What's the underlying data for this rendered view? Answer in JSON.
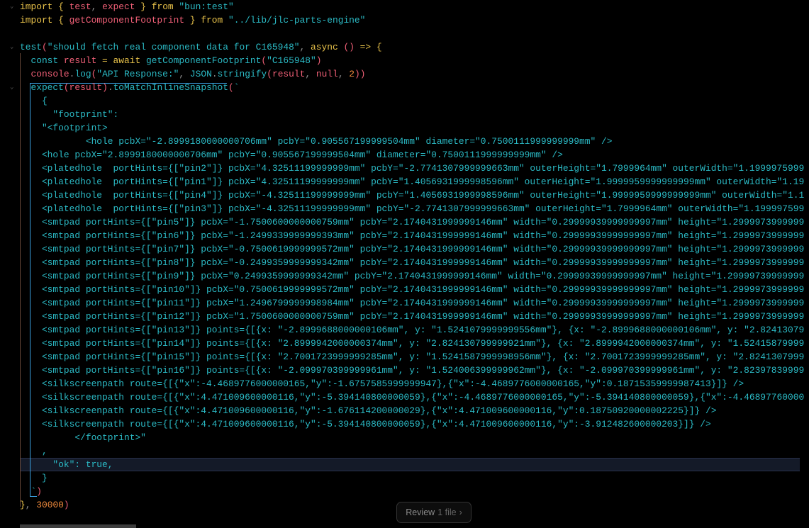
{
  "editor": {
    "lines": [
      [
        [
          "k",
          "import"
        ],
        [
          "o",
          " { "
        ],
        [
          "p",
          "test"
        ],
        [
          "g",
          ", "
        ],
        [
          "p",
          "expect"
        ],
        [
          "o",
          " } "
        ],
        [
          "k",
          "from"
        ],
        [
          "s",
          " \"bun:test\""
        ]
      ],
      [
        [
          "k",
          "import"
        ],
        [
          "o",
          " { "
        ],
        [
          "p",
          "getComponentFootprint"
        ],
        [
          "o",
          " } "
        ],
        [
          "k",
          "from"
        ],
        [
          "s",
          " \"../lib/jlc-parts-engine\""
        ]
      ],
      [],
      [
        [
          "c",
          "test"
        ],
        [
          "p",
          "("
        ],
        [
          "s",
          "\"should fetch real component data for C165948\""
        ],
        [
          "g",
          ", "
        ],
        [
          "k",
          "async"
        ],
        [
          "p",
          " () "
        ],
        [
          "o",
          "=>"
        ],
        [
          "o",
          " {"
        ]
      ],
      [
        [
          "c",
          "  const "
        ],
        [
          "p",
          "result"
        ],
        [
          "o",
          " = "
        ],
        [
          "k",
          "await "
        ],
        [
          "c",
          "getComponentFootprint"
        ],
        [
          "p",
          "("
        ],
        [
          "s",
          "\"C165948\""
        ],
        [
          "p",
          ")"
        ]
      ],
      [
        [
          "p",
          "  console"
        ],
        [
          "g",
          "."
        ],
        [
          "c",
          "log"
        ],
        [
          "p",
          "("
        ],
        [
          "s",
          "\"API Response:\""
        ],
        [
          "g",
          ", "
        ],
        [
          "c",
          "JSON"
        ],
        [
          "g",
          "."
        ],
        [
          "c",
          "stringify"
        ],
        [
          "p",
          "("
        ],
        [
          "p",
          "result"
        ],
        [
          "g",
          ", "
        ],
        [
          "p",
          "null"
        ],
        [
          "g",
          ", "
        ],
        [
          "n",
          "2"
        ],
        [
          "p",
          "))"
        ]
      ],
      [
        [
          "c",
          "  expect"
        ],
        [
          "p",
          "("
        ],
        [
          "p",
          "result"
        ],
        [
          "p",
          ")"
        ],
        [
          "g",
          "."
        ],
        [
          "c",
          "toMatchInlineSnapshot"
        ],
        [
          "p",
          "("
        ],
        [
          "s",
          "`"
        ]
      ],
      [
        [
          "s",
          "    {"
        ]
      ],
      [
        [
          "s",
          "      \"footprint\":"
        ]
      ],
      [
        [
          "s",
          "    \"<footprint>"
        ]
      ],
      [
        [
          "s",
          "            <hole pcbX=\"-2.8999180000000706mm\" pcbY=\"0.905567199999504mm\" diameter=\"0.7500111999999999mm\" />"
        ]
      ],
      [
        [
          "s",
          "    <hole pcbX=\"2.8999180000000706mm\" pcbY=\"0.905567199999504mm\" diameter=\"0.7500111999999999mm\" />"
        ]
      ],
      [
        [
          "s",
          "    <platedhole  portHints={[\"pin2\"]} pcbX=\"4.32511199999999mm\" pcbY=\"-2.7741307999999663mm\" outerHeight=\"1.7999964mm\" outerWidth=\"1.1999975999"
        ]
      ],
      [
        [
          "s",
          "    <platedhole  portHints={[\"pin1\"]} pcbX=\"4.32511199999999mm\" pcbY=\"1.4056931999998596mm\" outerHeight=\"1.9999959999999999mm\" outerWidth=\"1.19"
        ]
      ],
      [
        [
          "s",
          "    <platedhole  portHints={[\"pin4\"]} pcbX=\"-4.32511199999999mm\" pcbY=\"1.4056931999998596mm\" outerHeight=\"1.9999959999999999mm\" outerWidth=\"1.1"
        ]
      ],
      [
        [
          "s",
          "    <platedhole  portHints={[\"pin3\"]} pcbX=\"-4.32511199999999mm\" pcbY=\"-2.7741307999999663mm\" outerHeight=\"1.7999964mm\" outerWidth=\"1.199997599"
        ]
      ],
      [
        [
          "s",
          "    <smtpad portHints={[\"pin5\"]} pcbX=\"-1.7500600000000759mm\" pcbY=\"2.1740431999999146mm\" width=\"0.29999939999999997mm\" height=\"1.2999973999999"
        ]
      ],
      [
        [
          "s",
          "    <smtpad portHints={[\"pin6\"]} pcbX=\"-1.2499339999999393mm\" pcbY=\"2.1740431999999146mm\" width=\"0.29999939999999997mm\" height=\"1.2999973999999"
        ]
      ],
      [
        [
          "s",
          "    <smtpad portHints={[\"pin7\"]} pcbX=\"-0.7500619999999572mm\" pcbY=\"2.1740431999999146mm\" width=\"0.29999939999999997mm\" height=\"1.2999973999999"
        ]
      ],
      [
        [
          "s",
          "    <smtpad portHints={[\"pin8\"]} pcbX=\"-0.2499359999999342mm\" pcbY=\"2.1740431999999146mm\" width=\"0.29999939999999997mm\" height=\"1.2999973999999"
        ]
      ],
      [
        [
          "s",
          "    <smtpad portHints={[\"pin9\"]} pcbX=\"0.2499359999999342mm\" pcbY=\"2.1740431999999146mm\" width=\"0.29999939999999997mm\" height=\"1.29999739999999"
        ]
      ],
      [
        [
          "s",
          "    <smtpad portHints={[\"pin10\"]} pcbX=\"0.7500619999999572mm\" pcbY=\"2.1740431999999146mm\" width=\"0.29999939999999997mm\" height=\"1.2999973999999"
        ]
      ],
      [
        [
          "s",
          "    <smtpad portHints={[\"pin11\"]} pcbX=\"1.2496799999998984mm\" pcbY=\"2.1740431999999146mm\" width=\"0.29999939999999997mm\" height=\"1.2999973999999"
        ]
      ],
      [
        [
          "s",
          "    <smtpad portHints={[\"pin12\"]} pcbX=\"1.7500600000000759mm\" pcbY=\"2.1740431999999146mm\" width=\"0.29999939999999997mm\" height=\"1.2999973999999"
        ]
      ],
      [
        [
          "s",
          "    <smtpad portHints={[\"pin13\"]} points={[{x: \"-2.8999688000000106mm\", y: \"1.5241079999999556mm\"}, {x: \"-2.8999688000000106mm\", y: \"2.82413079"
        ]
      ],
      [
        [
          "s",
          "    <smtpad portHints={[\"pin14\"]} points={[{x: \"2.8999942000000374mm\", y: \"2.824130799999921mm\"}, {x: \"2.8999942000000374mm\", y: \"1.52415879999"
        ]
      ],
      [
        [
          "s",
          "    <smtpad portHints={[\"pin15\"]} points={[{x: \"2.7001723999999285mm\", y: \"1.5241587999998956mm\"}, {x: \"2.7001723999999285mm\", y: \"2.8241307999"
        ]
      ],
      [
        [
          "s",
          "    <smtpad portHints={[\"pin16\"]} points={[{x: \"-2.099970399999961mm\", y: \"1.524006399999962mm\"}, {x: \"-2.099970399999961mm\", y: \"2.82397839999"
        ]
      ],
      [
        [
          "s",
          "    <silkscreenpath route={[{\"x\":-4.4689776000000165,\"y\":-1.6757585999999947},{\"x\":-4.4689776000000165,\"y\":0.18715359999987413}]} />"
        ]
      ],
      [
        [
          "s",
          "    <silkscreenpath route={[{\"x\":4.471009600000116,\"y\":-5.394140800000059},{\"x\":-4.4689776000000165,\"y\":-5.394140800000059},{\"x\":-4.46897760000"
        ]
      ],
      [
        [
          "s",
          "    <silkscreenpath route={[{\"x\":4.471009600000116,\"y\":-1.676114200000029},{\"x\":4.471009600000116,\"y\":0.18750920000002225}]} />"
        ]
      ],
      [
        [
          "s",
          "    <silkscreenpath route={[{\"x\":4.471009600000116,\"y\":-5.394140800000059},{\"x\":4.471009600000116,\"y\":-3.912482600000203}]} />"
        ]
      ],
      [
        [
          "s",
          "          </footprint>\""
        ]
      ],
      [
        [
          "s",
          "    ,"
        ]
      ],
      [
        [
          "s",
          "      \"ok\": true,"
        ]
      ],
      [
        [
          "s",
          "    }"
        ]
      ],
      [
        [
          "s",
          "  `"
        ],
        [
          "p",
          ")"
        ]
      ],
      [
        [
          "o",
          "}"
        ],
        [
          "g",
          ", "
        ],
        [
          "n",
          "30000"
        ],
        [
          "p",
          ")"
        ]
      ]
    ]
  },
  "review_button": {
    "label": "Review",
    "count": "1 file",
    "chevron": "›"
  }
}
